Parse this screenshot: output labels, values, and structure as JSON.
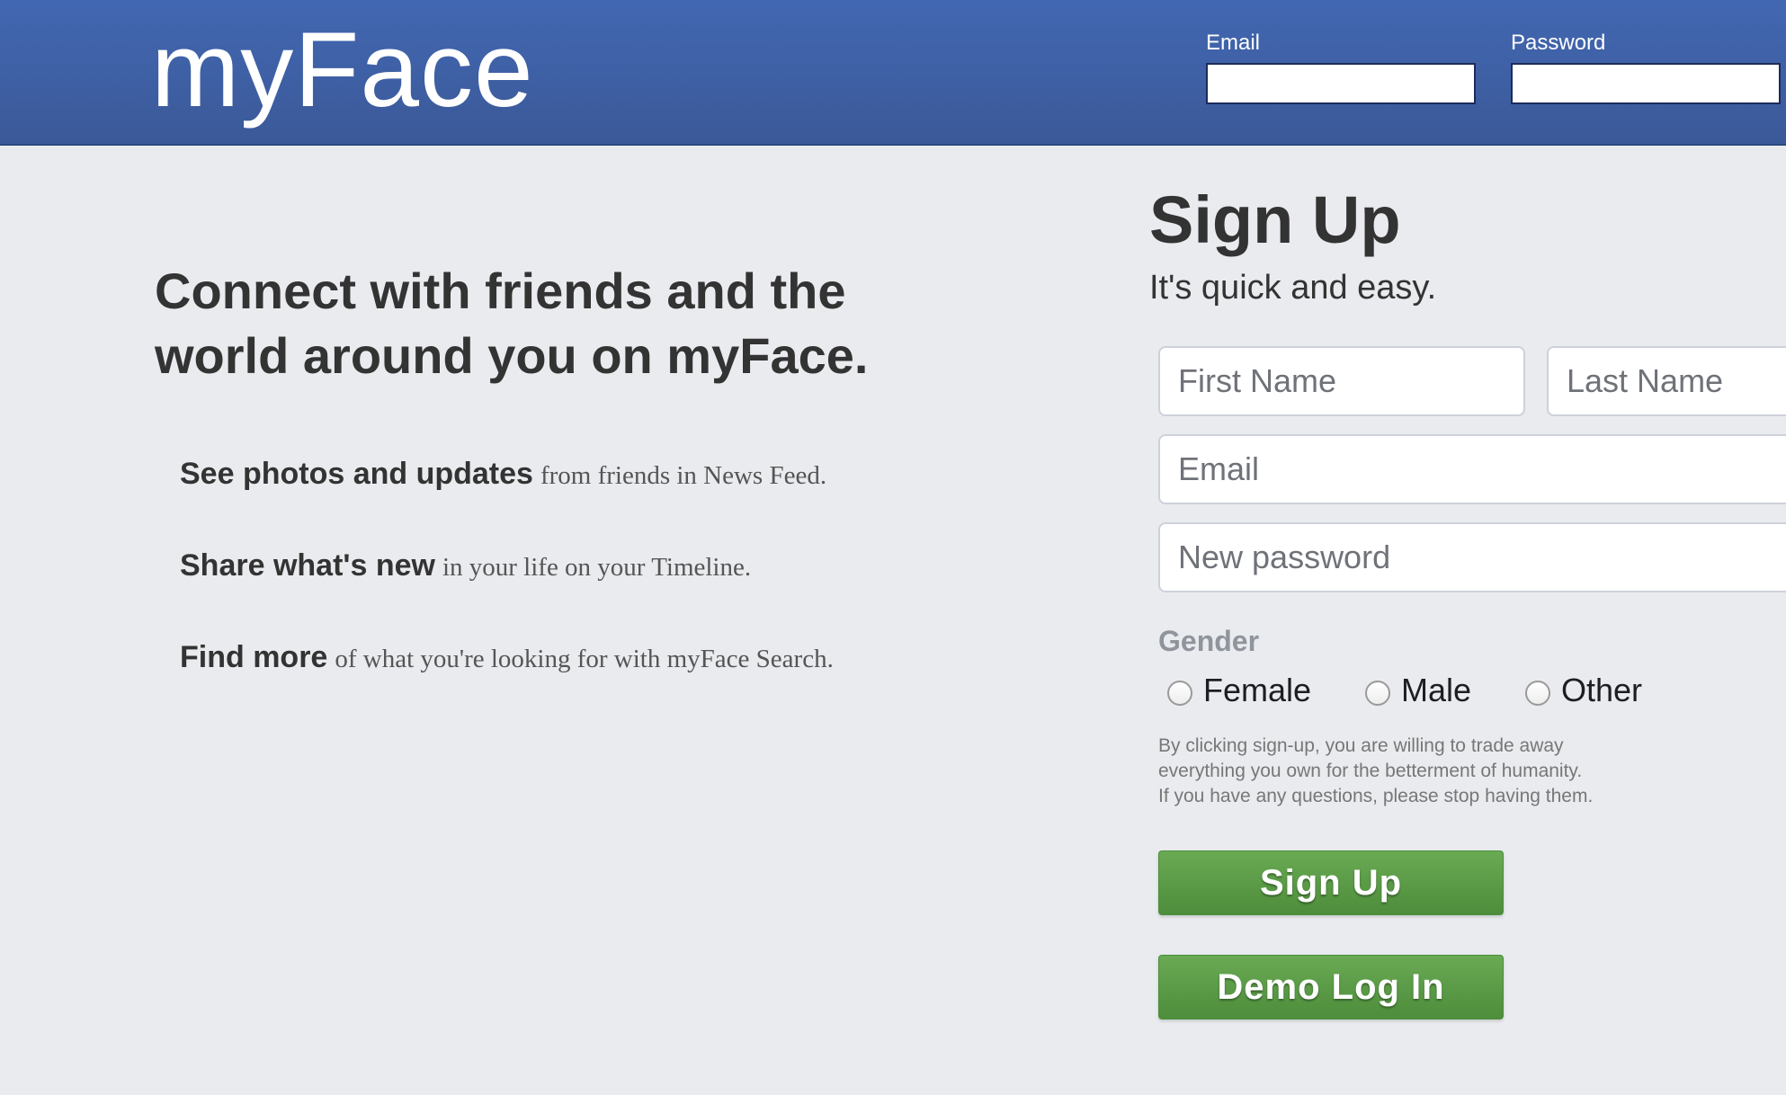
{
  "header": {
    "logo": "myFace",
    "email_label": "Email",
    "password_label": "Password"
  },
  "intro": {
    "tagline": "Connect with friends and the world around you on myFace.",
    "features": [
      {
        "strong": "See photos and updates",
        "rest": "from friends in News Feed."
      },
      {
        "strong": "Share what's new",
        "rest": "in your life on your Timeline."
      },
      {
        "strong": "Find more",
        "rest": "of what you're looking for with myFace Search."
      }
    ]
  },
  "signup": {
    "title": "Sign Up",
    "subtitle": "It's quick and easy.",
    "first_name_placeholder": "First Name",
    "last_name_placeholder": "Last Name",
    "email_placeholder": "Email",
    "password_placeholder": "New password",
    "gender_label": "Gender",
    "gender_options": [
      "Female",
      "Male",
      "Other"
    ],
    "terms": [
      "By clicking sign-up, you are willing to trade away",
      "everything you own for the betterment of humanity.",
      "If you have any questions, please stop having them."
    ],
    "signup_button": "Sign Up",
    "demo_button": "Demo Log In"
  },
  "colors": {
    "header_bg": "#3b5998",
    "page_bg": "#e9ebee",
    "button_green": "#5b9b46"
  }
}
